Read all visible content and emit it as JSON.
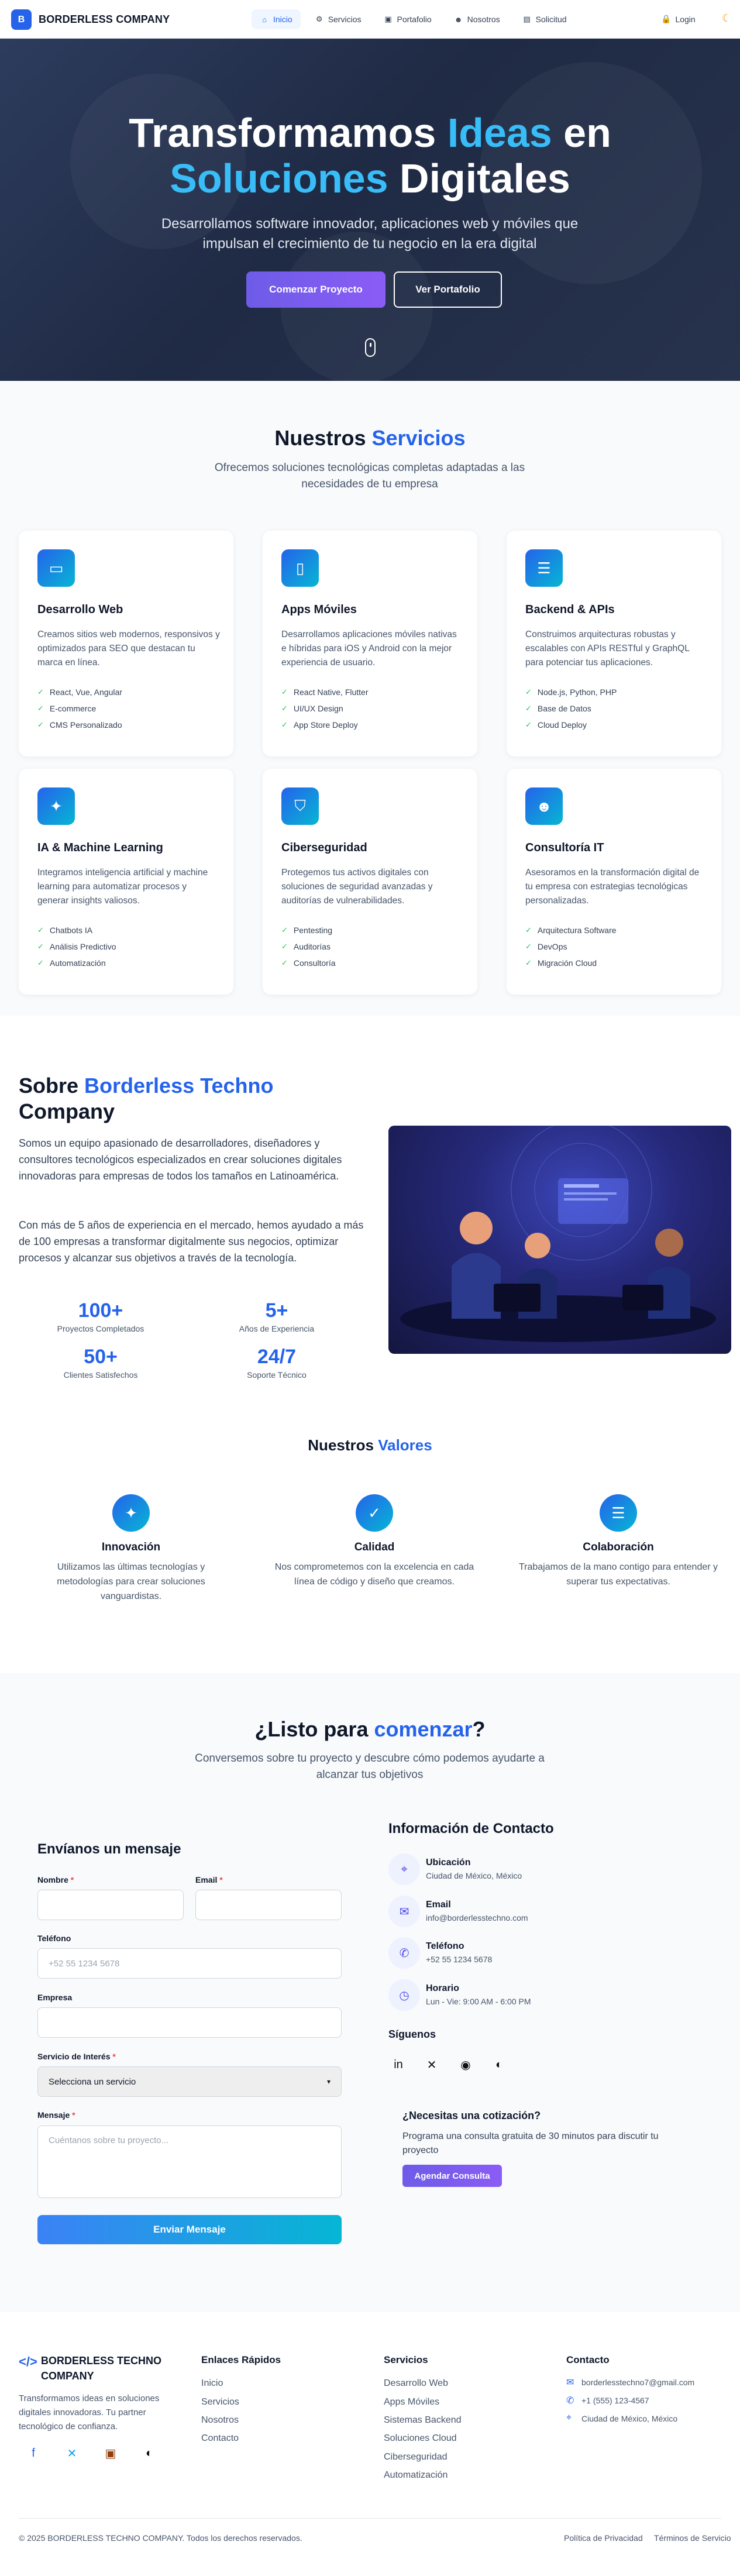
{
  "nav": {
    "logo_letter": "B",
    "brand": "BORDERLESS COMPANY",
    "items": [
      {
        "label": "Inicio",
        "icon": "home-icon",
        "active": true
      },
      {
        "label": "Servicios",
        "icon": "gear-icon",
        "active": false
      },
      {
        "label": "Portafolio",
        "icon": "briefcase-icon",
        "active": false
      },
      {
        "label": "Nosotros",
        "icon": "users-icon",
        "active": false
      },
      {
        "label": "Solicitud",
        "icon": "clipboard-icon",
        "active": false
      }
    ],
    "login": "Login",
    "theme_icon": "moon-icon"
  },
  "hero": {
    "title_1": "Transformamos ",
    "title_hl_1": "Ideas",
    "title_2": " en",
    "title_hl_2": "Soluciones",
    "title_3": " Digitales",
    "subtitle": "Desarrollamos software innovador, aplicaciones web y móviles que impulsan el crecimiento de tu negocio en la era digital",
    "cta_primary": "Comenzar Proyecto",
    "cta_secondary": "Ver Portafolio"
  },
  "services": {
    "title": "Nuestros ",
    "title_hl": "Servicios",
    "subtitle": "Ofrecemos soluciones tecnológicas completas adaptadas a las necesidades de tu empresa",
    "cards": [
      {
        "icon": "monitor-icon",
        "title": "Desarrollo Web",
        "desc": "Creamos sitios web modernos, responsivos y optimizados para SEO que destacan tu marca en línea.",
        "features": [
          "React, Vue, Angular",
          "E-commerce",
          "CMS Personalizado"
        ]
      },
      {
        "icon": "smartphone-icon",
        "title": "Apps Móviles",
        "desc": "Desarrollamos aplicaciones móviles nativas e híbridas para iOS y Android con la mejor experiencia de usuario.",
        "features": [
          "React Native, Flutter",
          "UI/UX Design",
          "App Store Deploy"
        ]
      },
      {
        "icon": "server-icon",
        "title": "Backend & APIs",
        "desc": "Construimos arquitecturas robustas y escalables con APIs RESTful y GraphQL para potenciar tus aplicaciones.",
        "features": [
          "Node.js, Python, PHP",
          "Base de Datos",
          "Cloud Deploy"
        ]
      },
      {
        "icon": "lightbulb-icon",
        "title": "IA & Machine Learning",
        "desc": "Integramos inteligencia artificial y machine learning para automatizar procesos y generar insights valiosos.",
        "features": [
          "Chatbots IA",
          "Análisis Predictivo",
          "Automatización"
        ]
      },
      {
        "icon": "shield-icon",
        "title": "Ciberseguridad",
        "desc": "Protegemos tus activos digitales con soluciones de seguridad avanzadas y auditorías de vulnerabilidades.",
        "features": [
          "Pentesting",
          "Auditorías",
          "Consultoría"
        ]
      },
      {
        "icon": "users-icon",
        "title": "Consultoría IT",
        "desc": "Asesoramos en la transformación digital de tu empresa con estrategias tecnológicas personalizadas.",
        "features": [
          "Arquitectura Software",
          "DevOps",
          "Migración Cloud"
        ]
      }
    ]
  },
  "about": {
    "title": "Sobre ",
    "title_hl": "Borderless Techno",
    "title_2": "Company",
    "p1": "Somos un equipo apasionado de desarrolladores, diseñadores y consultores tecnológicos especializados en crear soluciones digitales innovadoras para empresas de todos los tamaños en Latinoamérica.",
    "p2": "Con más de 5 años de experiencia en el mercado, hemos ayudado a más de 100 empresas a transformar digitalmente sus negocios, optimizar procesos y alcanzar sus objetivos a través de la tecnología.",
    "stats": [
      {
        "value": "100+",
        "label": "Proyectos Completados"
      },
      {
        "value": "5+",
        "label": "Años de Experiencia"
      },
      {
        "value": "50+",
        "label": "Clientes Satisfechos"
      },
      {
        "value": "24/7",
        "label": "Soporte Técnico"
      }
    ],
    "values_title": "Nuestros ",
    "values_title_hl": "Valores",
    "values": [
      {
        "icon": "lightbulb-icon",
        "title": "Innovación",
        "desc": "Utilizamos las últimas tecnologías y metodologías para crear soluciones vanguardistas."
      },
      {
        "icon": "check-circle-icon",
        "title": "Calidad",
        "desc": "Nos comprometemos con la excelencia en cada línea de código y diseño que creamos."
      },
      {
        "icon": "team-icon",
        "title": "Colaboración",
        "desc": "Trabajamos de la mano contigo para entender y superar tus expectativas."
      }
    ]
  },
  "contact": {
    "title": "¿Listo para ",
    "title_hl": "comenzar",
    "title_end": "?",
    "subtitle": "Conversemos sobre tu proyecto y descubre cómo podemos ayudarte a alcanzar tus objetivos",
    "form_title": "Envíanos un mensaje",
    "name_label": "Nombre",
    "email_label": "Email",
    "phone_label": "Teléfono",
    "phone_placeholder": "+52 55 1234 5678",
    "company_label": "Empresa",
    "service_label": "Servicio de Interés",
    "service_value": "Selecciona un servicio",
    "message_label": "Mensaje",
    "message_placeholder": "Cuéntanos sobre tu proyecto...",
    "required_mark": "*",
    "submit": "Enviar Mensaje",
    "info_title": "Información de Contacto",
    "info": [
      {
        "icon": "map-pin-icon",
        "title": "Ubicación",
        "value": "Ciudad de México, México"
      },
      {
        "icon": "mail-icon",
        "title": "Email",
        "value": "info@borderlesstechno.com"
      },
      {
        "icon": "phone-icon",
        "title": "Teléfono",
        "value": "+52 55 1234 5678"
      },
      {
        "icon": "clock-icon",
        "title": "Horario",
        "value": "Lun - Vie: 9:00 AM - 6:00 PM"
      }
    ],
    "follow_title": "Síguenos",
    "socials": [
      "linkedin-icon",
      "twitter-icon",
      "pinterest-icon",
      "github-icon"
    ],
    "quote_title": "¿Necesitas una cotización?",
    "quote_desc": "Programa una consulta gratuita de 30 minutos para discutir tu proyecto",
    "quote_btn": "Agendar Consulta"
  },
  "footer": {
    "brand": "BORDERLESS TECHNO COMPANY",
    "desc": "Transformamos ideas en soluciones digitales innovadoras. Tu partner tecnológico de confianza.",
    "socials": [
      "facebook-icon",
      "twitter-icon",
      "briefcase-icon",
      "github-icon"
    ],
    "links_title": "Enlaces Rápidos",
    "links": [
      "Inicio",
      "Servicios",
      "Nosotros",
      "Contacto"
    ],
    "services_title": "Servicios",
    "services": [
      "Desarrollo Web",
      "Apps Móviles",
      "Sistemas Backend",
      "Soluciones Cloud",
      "Ciberseguridad",
      "Automatización"
    ],
    "contact_title": "Contacto",
    "contact": [
      {
        "icon": "mail-icon",
        "value": "borderlesstechno7@gmail.com"
      },
      {
        "icon": "phone-icon",
        "value": "+1 (555) 123-4567"
      },
      {
        "icon": "map-pin-icon",
        "value": "Ciudad de México, México"
      }
    ],
    "copyright": "© 2025 BORDERLESS TECHNO COMPANY. Todos los derechos reservados.",
    "privacy": "Política de Privacidad",
    "terms": "Términos de Servicio"
  }
}
